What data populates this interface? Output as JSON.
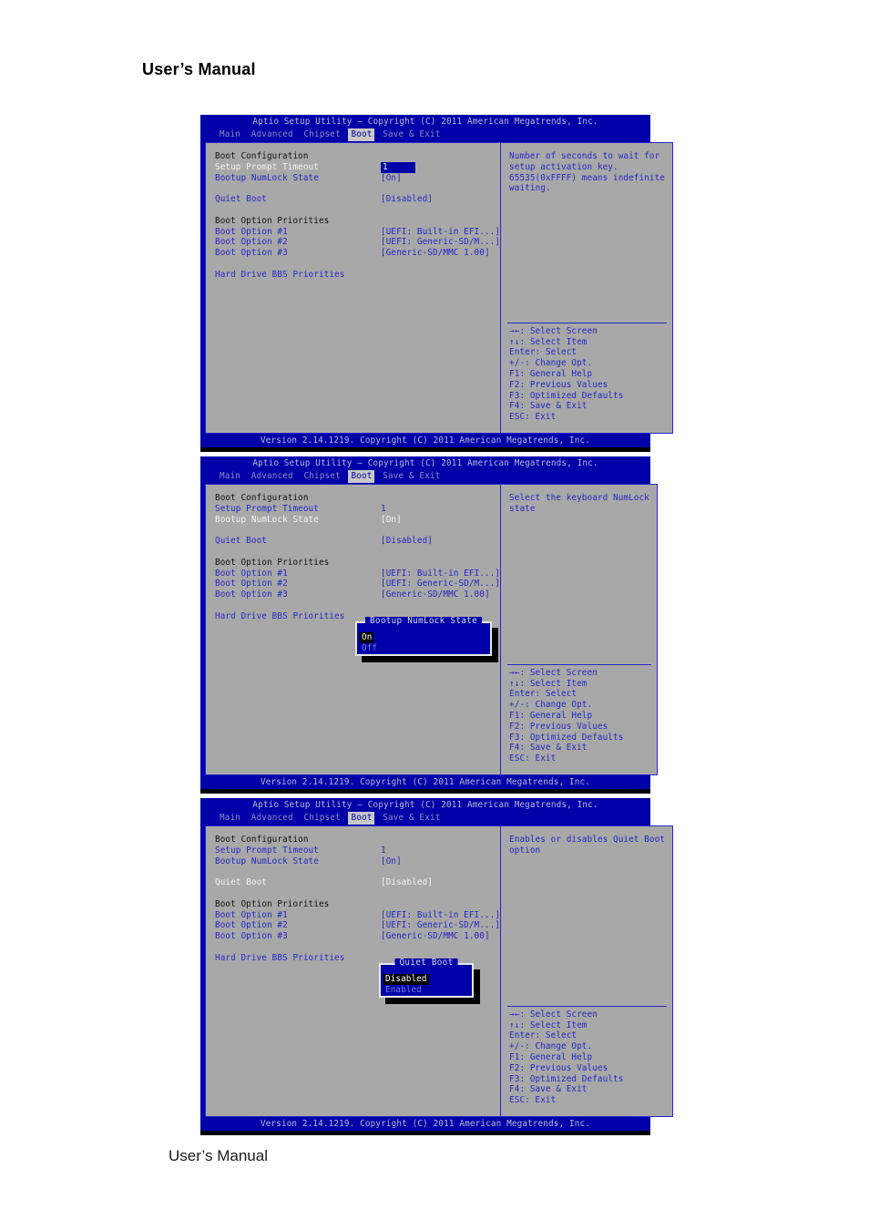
{
  "document": {
    "header_title": "User’s Manual",
    "footer_title": "User’s Manual"
  },
  "bios": {
    "titlebar": "Aptio Setup Utility – Copyright (C) 2011 American Megatrends, Inc.",
    "versionbar": "Version 2.14.1219. Copyright (C) 2011 American Megatrends, Inc.",
    "menu": [
      {
        "label": "Main",
        "active": false
      },
      {
        "label": "Advanced",
        "active": false
      },
      {
        "label": "Chipset",
        "active": false
      },
      {
        "label": "Boot",
        "active": true
      },
      {
        "label": "Save & Exit",
        "active": false
      }
    ],
    "rows": {
      "boot_configuration": "Boot Configuration",
      "setup_prompt_timeout_label": "Setup Prompt Timeout",
      "setup_prompt_timeout_value": "1",
      "bootup_numlock_label": "Bootup NumLock State",
      "bootup_numlock_value": "[On]",
      "quiet_boot_label": "Quiet Boot",
      "quiet_boot_value": "[Disabled]",
      "boot_option_priorities": "Boot Option Priorities",
      "boot_option_1_label": "Boot Option #1",
      "boot_option_1_value": "[UEFI: Built-in EFI...]",
      "boot_option_2_label": "Boot Option #2",
      "boot_option_2_value": "[UEFI: Generic-SD/M...]",
      "boot_option_3_label": "Boot Option #3",
      "boot_option_3_value": "[Generic-SD/MMC 1.00]",
      "hard_drive_bbs": "Hard Drive BBS Priorities"
    },
    "keys": [
      "→←: Select Screen",
      "↑↓: Select Item",
      "Enter: Select",
      "+/-: Change Opt.",
      "F1: General Help",
      "F2: Previous Values",
      "F3: Optimized Defaults",
      "F4: Save & Exit",
      "ESC: Exit"
    ],
    "colors": {
      "screen_blue": "#0000a8",
      "pane_gray": "#a8a8a8",
      "label_blue": "#2626c6",
      "selected_white": "#f4f4f4",
      "tab_active_bg": "#c8c8c8"
    }
  },
  "panels": {
    "panel1": {
      "help_lines": [
        "Number of seconds to wait for",
        "setup activation key.",
        "65535(0xFFFF) means indefinite",
        "waiting."
      ],
      "selected_row": "Setup Prompt Timeout"
    },
    "panel2": {
      "help_lines": [
        "Select the keyboard NumLock",
        "state"
      ],
      "selected_row": "Bootup NumLock State",
      "popup": {
        "title": "Bootup NumLock State",
        "options": [
          {
            "label": "On",
            "selected": true
          },
          {
            "label": "Off",
            "selected": false
          }
        ]
      }
    },
    "panel3": {
      "help_lines": [
        "Enables or disables Quiet Boot",
        "option"
      ],
      "selected_row": "Quiet Boot",
      "popup": {
        "title": "Quiet Boot",
        "options": [
          {
            "label": "Disabled",
            "selected": true
          },
          {
            "label": "Enabled",
            "selected": false
          }
        ]
      }
    }
  }
}
